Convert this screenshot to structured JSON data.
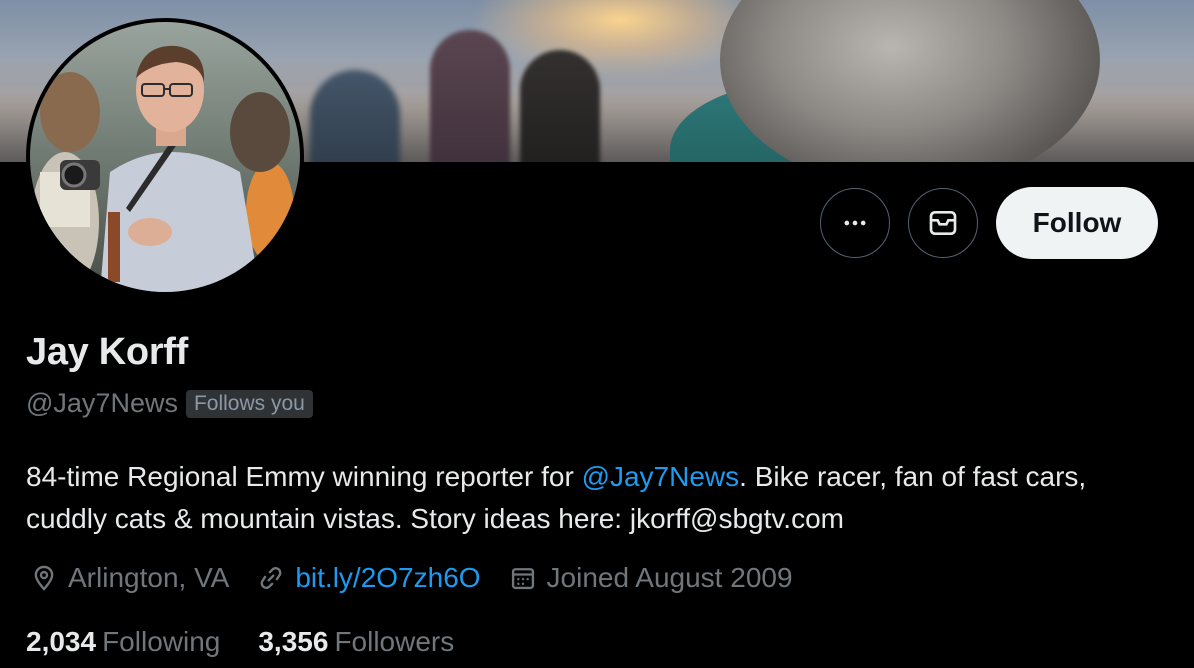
{
  "profile": {
    "name": "Jay Korff",
    "handle": "@Jay7News",
    "follows_you_badge": "Follows you",
    "bio": {
      "prefix": "84-time Regional Emmy winning reporter for ",
      "mention": "@Jay7News",
      "suffix": ". Bike racer, fan of fast cars, cuddly cats & mountain vistas. Story ideas here: jkorff@sbgtv.com"
    },
    "location": "Arlington, VA",
    "website": "bit.ly/2O7zh6O",
    "joined": "Joined August 2009",
    "following_count": "2,034",
    "following_label": "Following",
    "followers_count": "3,356",
    "followers_label": "Followers"
  },
  "actions": {
    "more_icon": "more-horizontal-icon",
    "message_icon": "envelope-icon",
    "follow_label": "Follow"
  },
  "icons": {
    "location": "location-pin-icon",
    "link": "link-icon",
    "calendar": "calendar-icon"
  },
  "colors": {
    "background": "#000000",
    "link": "#1d9bf0",
    "secondary_text": "#71767b",
    "follow_button_bg": "#eff3f4"
  }
}
